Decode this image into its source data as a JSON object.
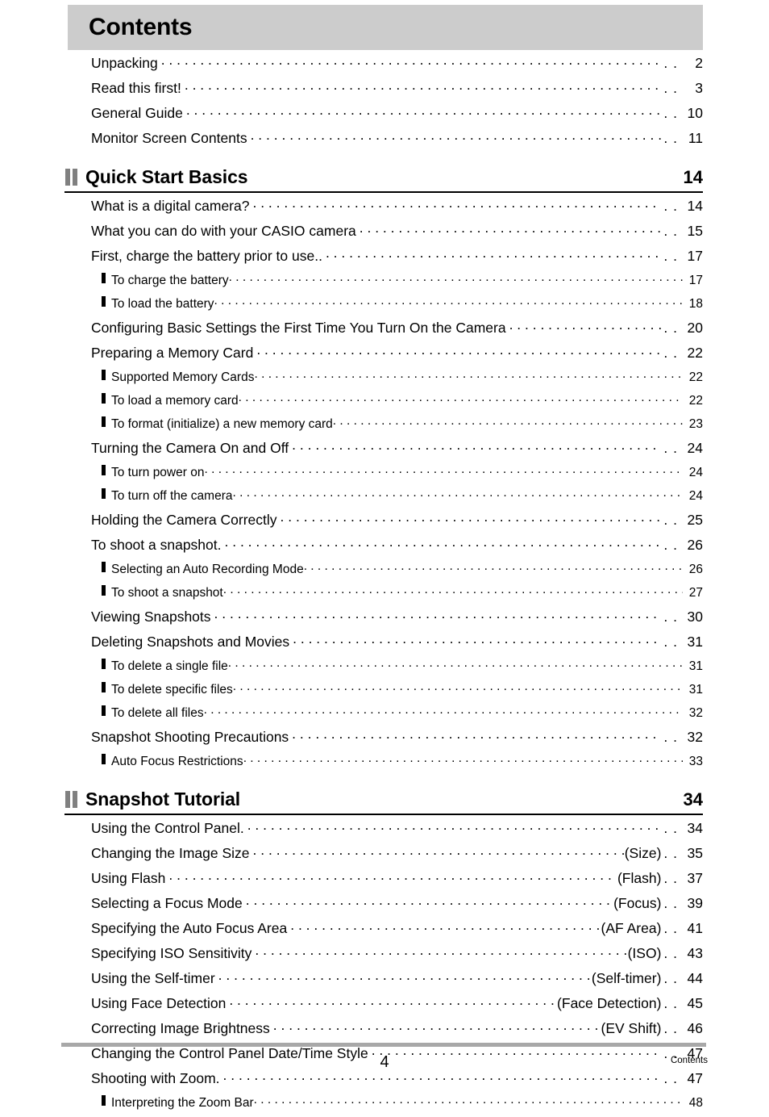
{
  "document": {
    "title": "Contents",
    "footer": {
      "page_number": "4",
      "section_label": "Contents"
    }
  },
  "intro_entries": [
    {
      "label": "Unpacking",
      "page": "2"
    },
    {
      "label": "Read this first!",
      "page": "3"
    },
    {
      "label": "General Guide",
      "page": "10"
    },
    {
      "label": "Monitor Screen Contents",
      "page": "11"
    }
  ],
  "sections": [
    {
      "title": "Quick Start Basics",
      "page": "14",
      "entries": [
        {
          "level": 1,
          "label": "What is a digital camera?",
          "page": "14"
        },
        {
          "level": 1,
          "label": "What you can do with your CASIO camera",
          "page": "15"
        },
        {
          "level": 1,
          "label": "First, charge the battery prior to use..",
          "page": "17"
        },
        {
          "level": 2,
          "label": "To charge the battery",
          "page": "17"
        },
        {
          "level": 2,
          "label": "To load the battery",
          "page": "18"
        },
        {
          "level": 1,
          "label": "Configuring Basic Settings the First Time You Turn On the Camera",
          "page": "20"
        },
        {
          "level": 1,
          "label": "Preparing a Memory Card",
          "page": "22"
        },
        {
          "level": 2,
          "label": "Supported Memory Cards",
          "page": "22"
        },
        {
          "level": 2,
          "label": "To load a memory card",
          "page": "22"
        },
        {
          "level": 2,
          "label": "To format (initialize) a new memory card",
          "page": "23"
        },
        {
          "level": 1,
          "label": "Turning the Camera On and Off",
          "page": "24"
        },
        {
          "level": 2,
          "label": "To turn power on",
          "page": "24"
        },
        {
          "level": 2,
          "label": "To turn off the camera",
          "page": "24"
        },
        {
          "level": 1,
          "label": "Holding the Camera Correctly",
          "page": "25"
        },
        {
          "level": 1,
          "label": "To shoot a snapshot.",
          "page": "26"
        },
        {
          "level": 2,
          "label": "Selecting an Auto Recording Mode",
          "page": "26"
        },
        {
          "level": 2,
          "label": "To shoot a snapshot",
          "page": "27"
        },
        {
          "level": 1,
          "label": "Viewing Snapshots",
          "page": "30"
        },
        {
          "level": 1,
          "label": "Deleting Snapshots and Movies",
          "page": "31"
        },
        {
          "level": 2,
          "label": "To delete a single file",
          "page": "31"
        },
        {
          "level": 2,
          "label": "To delete specific files",
          "page": "31"
        },
        {
          "level": 2,
          "label": "To delete all files",
          "page": "32"
        },
        {
          "level": 1,
          "label": "Snapshot Shooting Precautions",
          "page": "32"
        },
        {
          "level": 2,
          "label": "Auto Focus Restrictions",
          "page": "33"
        }
      ]
    },
    {
      "title": "Snapshot Tutorial",
      "page": "34",
      "entries": [
        {
          "level": 1,
          "label": "Using the Control Panel.",
          "tag": "",
          "page": "34"
        },
        {
          "level": 1,
          "label": "Changing the Image Size",
          "tag": "(Size)",
          "page": "35"
        },
        {
          "level": 1,
          "label": "Using Flash",
          "tag": "(Flash)",
          "page": "37"
        },
        {
          "level": 1,
          "label": "Selecting a Focus Mode",
          "tag": "(Focus)",
          "page": "39"
        },
        {
          "level": 1,
          "label": "Specifying the Auto Focus Area",
          "tag": "(AF Area)",
          "page": "41"
        },
        {
          "level": 1,
          "label": "Specifying ISO Sensitivity",
          "tag": "(ISO)",
          "page": "43"
        },
        {
          "level": 1,
          "label": "Using the Self-timer",
          "tag": "(Self-timer)",
          "page": "44"
        },
        {
          "level": 1,
          "label": "Using Face Detection",
          "tag": "(Face Detection)",
          "page": "45"
        },
        {
          "level": 1,
          "label": "Correcting Image Brightness",
          "tag": "(EV Shift)",
          "page": "46"
        },
        {
          "level": 1,
          "label": "Changing the Control Panel Date/Time Style",
          "tag": "",
          "page": "47"
        },
        {
          "level": 1,
          "label": "Shooting with Zoom.",
          "tag": "",
          "page": "47"
        },
        {
          "level": 2,
          "label": "Interpreting the Zoom Bar",
          "tag": "",
          "page": "48"
        }
      ]
    }
  ],
  "separator_dots": ". ."
}
